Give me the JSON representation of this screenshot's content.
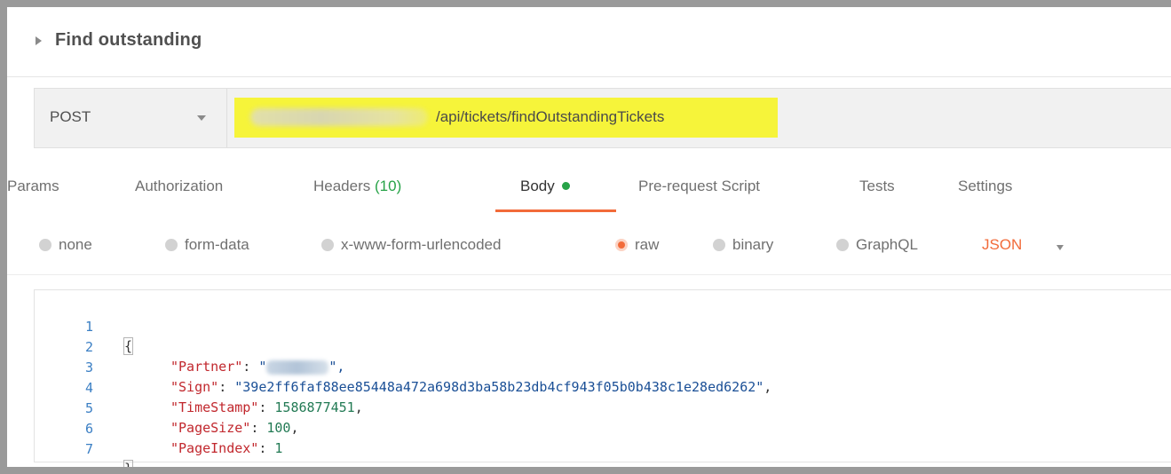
{
  "request": {
    "name": "Find outstanding",
    "method": "POST",
    "url_path": "/api/tickets/findOutstandingTickets"
  },
  "tabs": [
    {
      "label": "Params"
    },
    {
      "label": "Authorization"
    },
    {
      "label": "Headers",
      "count": "(10)"
    },
    {
      "label": "Body",
      "active": true
    },
    {
      "label": "Pre-request Script"
    },
    {
      "label": "Tests"
    },
    {
      "label": "Settings"
    }
  ],
  "body_types": [
    {
      "label": "none"
    },
    {
      "label": "form-data"
    },
    {
      "label": "x-www-form-urlencoded"
    },
    {
      "label": "raw",
      "selected": true
    },
    {
      "label": "binary"
    },
    {
      "label": "GraphQL"
    }
  ],
  "raw_language": "JSON",
  "editor": {
    "line_numbers": [
      "1",
      "2",
      "3",
      "4",
      "5",
      "6",
      "7"
    ],
    "open_brace": "{",
    "close_brace": "}",
    "lines": [
      {
        "key": "\"Partner\"",
        "value_prefix": "\"",
        "value_suffix": "\","
      },
      {
        "key": "\"Sign\"",
        "value": "\"39e2ff6faf88ee85448a472a698d3ba58b23db4cf943f05b0b438c1e28ed6262\"",
        "trail": ","
      },
      {
        "key": "\"TimeStamp\"",
        "value": "1586877451",
        "trail": ","
      },
      {
        "key": "\"PageSize\"",
        "value": "100",
        "trail": ","
      },
      {
        "key": "\"PageIndex\"",
        "value": "1",
        "trail": ""
      }
    ]
  },
  "colors": {
    "accent": "#f26b3a",
    "highlight": "#f6f43a",
    "success": "#27a348"
  }
}
